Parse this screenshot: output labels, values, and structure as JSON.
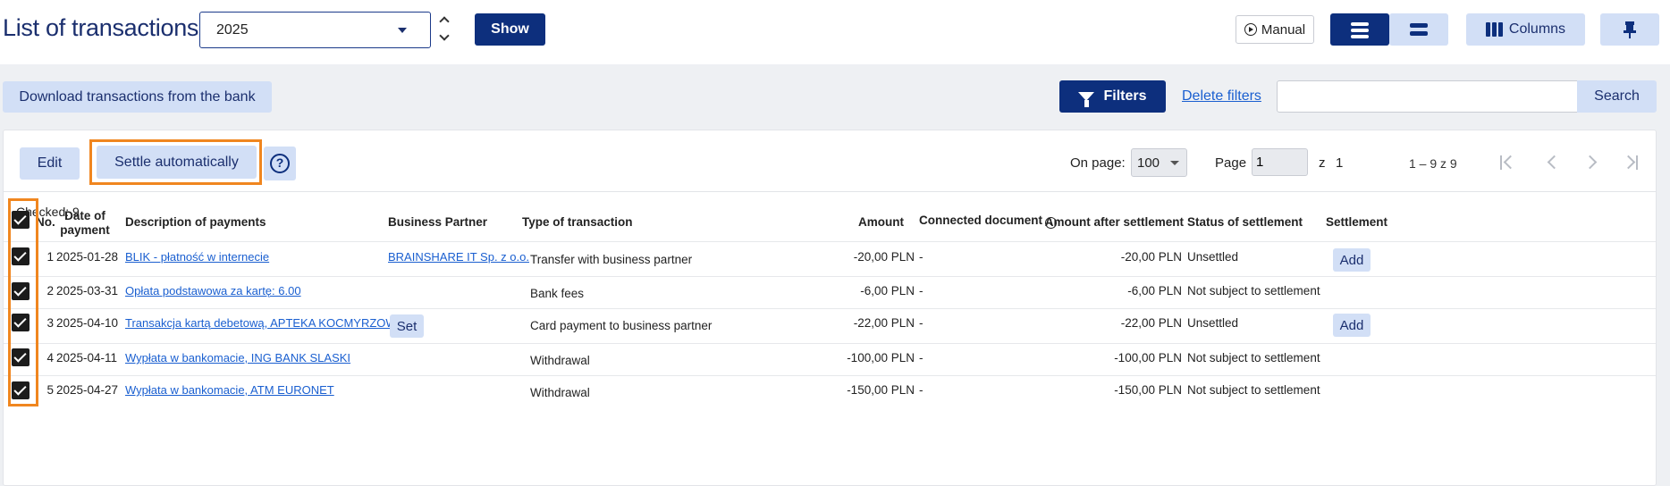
{
  "header": {
    "title": "List of transactions",
    "year": "2025",
    "show_label": "Show",
    "manual_label": "Manual",
    "columns_label": "Columns"
  },
  "filterbar": {
    "download_label": "Download transactions from the bank",
    "filters_label": "Filters",
    "delete_filters_label": "Delete filters",
    "search_value": "",
    "search_label": "Search"
  },
  "toolbar": {
    "edit_label": "Edit",
    "settle_label": "Settle automatically",
    "help_glyph": "?"
  },
  "pagination": {
    "on_page_label": "On page:",
    "on_page_value": "100",
    "page_label": "Page",
    "page_value": "1",
    "of_label": "z",
    "total_pages": "1",
    "range_text": "1 – 9 z 9"
  },
  "checked_text": "Checked: 9",
  "table": {
    "headers": {
      "no": "No.",
      "date": "Date of payment",
      "description": "Description of payments",
      "partner": "Business Partner",
      "type": "Type of transaction",
      "amount": "Amount",
      "connected": "Connected document",
      "amount_after": "Amount after settlement",
      "status": "Status of settlement",
      "settlement": "Settlement"
    },
    "rows": [
      {
        "no": "1",
        "date": "2025-01-28",
        "description": "BLIK - płatność w internecie",
        "partner": "BRAINSHARE IT Sp. z o.o.",
        "partner_action": "",
        "type": "Transfer with business partner",
        "amount": "-20,00 PLN",
        "connected": "-",
        "amount_after": "-20,00 PLN",
        "status": "Unsettled",
        "action": "Add"
      },
      {
        "no": "2",
        "date": "2025-03-31",
        "description": "Opłata podstawowa za kartę: 6.00",
        "partner": "",
        "partner_action": "",
        "type": "Bank fees",
        "amount": "-6,00 PLN",
        "connected": "-",
        "amount_after": "-6,00 PLN",
        "status": "Not subject to settlement",
        "action": ""
      },
      {
        "no": "3",
        "date": "2025-04-10",
        "description": "Transakcja kartą debetową, APTEKA KOCMYRZOWSKA",
        "partner": "",
        "partner_action": "Set",
        "type": "Card payment to business partner",
        "amount": "-22,00 PLN",
        "connected": "-",
        "amount_after": "-22,00 PLN",
        "status": "Unsettled",
        "action": "Add"
      },
      {
        "no": "4",
        "date": "2025-04-11",
        "description": "Wypłata w bankomacie, ING BANK SLASKI",
        "partner": "",
        "partner_action": "",
        "type": "Withdrawal",
        "amount": "-100,00 PLN",
        "connected": "-",
        "amount_after": "-100,00 PLN",
        "status": "Not subject to settlement",
        "action": ""
      },
      {
        "no": "5",
        "date": "2025-04-27",
        "description": "Wypłata w bankomacie, ATM EURONET",
        "partner": "",
        "partner_action": "",
        "type": "Withdrawal",
        "amount": "-150,00 PLN",
        "connected": "-",
        "amount_after": "-150,00 PLN",
        "status": "Not subject to settlement",
        "action": ""
      }
    ]
  },
  "colors": {
    "primary": "#0d2f7d",
    "secondary": "#d2dff6",
    "highlight": "#f0861f",
    "link": "#1a5fd0"
  }
}
